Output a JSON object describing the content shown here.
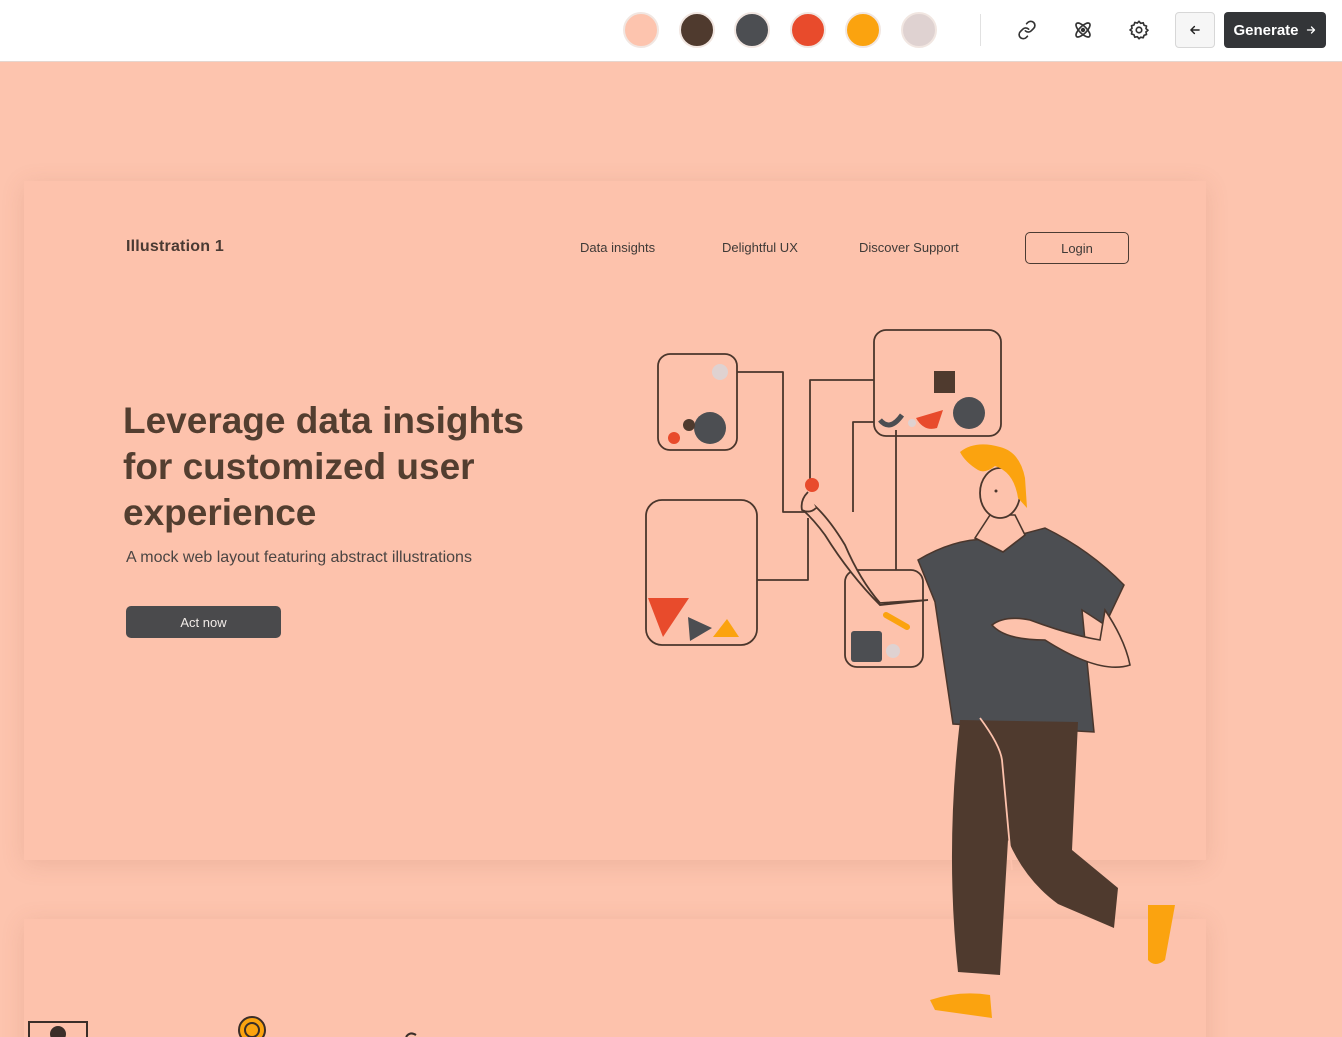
{
  "toolbar": {
    "swatches": [
      {
        "name": "peach",
        "color": "#fdc4ae"
      },
      {
        "name": "dark-brown",
        "color": "#4f3a2e"
      },
      {
        "name": "charcoal",
        "color": "#4c4e52"
      },
      {
        "name": "red-orange",
        "color": "#e84b2c"
      },
      {
        "name": "amber",
        "color": "#fba30f"
      },
      {
        "name": "light-gray-pink",
        "color": "#dfd2d1"
      }
    ],
    "icons": [
      "link-icon",
      "react-atom-icon",
      "gear-icon",
      "arrow-left-icon",
      "arrow-right-icon"
    ],
    "generate_label": "Generate"
  },
  "preview": {
    "brand": "Illustration 1",
    "nav": [
      "Data insights",
      "Delightful UX",
      "Discover Support"
    ],
    "login_label": "Login",
    "hero_title": "Leverage data insights for customized user experience",
    "hero_subtitle": "A mock web layout featuring abstract illustrations",
    "cta_label": "Act now"
  },
  "colors": {
    "background": "#fdc4ae",
    "primary_text": "#533e30",
    "button_dark": "#4a4a4c",
    "toolbar_button": "#333538"
  }
}
